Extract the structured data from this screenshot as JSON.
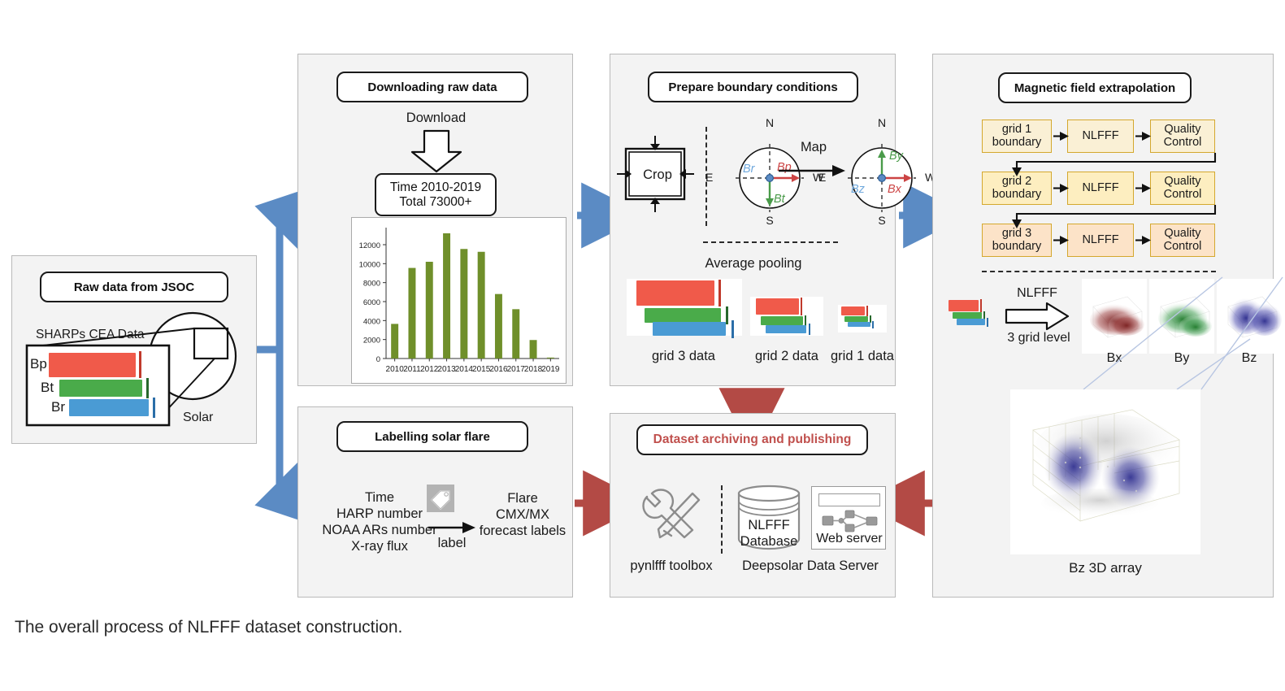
{
  "figure": {
    "caption": "The overall process of NLFFF dataset construction."
  },
  "panels": {
    "jsoc": {
      "title": "Raw data from JSOC",
      "subtitle": "SHARPs CEA Data",
      "solar_label": "Solar",
      "component_labels": [
        "Bp",
        "Bt",
        "Br"
      ],
      "component_colors": [
        "#f05a4a",
        "#4aab4a",
        "#4a9bd4"
      ]
    },
    "download": {
      "title": "Downloading raw data",
      "arrow_label": "Download",
      "summary_line1": "Time 2010-2019",
      "summary_line2": "Total  73000+"
    },
    "boundary": {
      "title": "Prepare boundary conditions",
      "crop_label": "Crop",
      "map_label": "Map",
      "compass_left": {
        "n": "N",
        "s": "S",
        "e": "E",
        "w": "W",
        "vectors": [
          {
            "name": "Bp",
            "color": "#cc4444"
          },
          {
            "name": "Bt",
            "color": "#4a9b4a"
          },
          {
            "name": "Br",
            "color": "#6fa8dc"
          }
        ]
      },
      "compass_right": {
        "n": "N",
        "s": "S",
        "e": "E",
        "w": "W",
        "vectors": [
          {
            "name": "Bx",
            "color": "#cc4444"
          },
          {
            "name": "By",
            "color": "#4a9b4a"
          },
          {
            "name": "Bz",
            "color": "#6fa8dc"
          }
        ]
      },
      "pooling_label": "Average pooling",
      "grid_labels": [
        "grid 3 data",
        "grid 2 data",
        "grid 1 data"
      ]
    },
    "extrapolation": {
      "title": "Magnetic field extrapolation",
      "rows": [
        {
          "boundary": "grid 1\nboundary",
          "solver": "NLFFF",
          "qc": "Quality\nControl",
          "fill": "#faf0d5",
          "border": "#d4a82e"
        },
        {
          "boundary": "grid 2\nboundary",
          "solver": "NLFFF",
          "qc": "Quality\nControl",
          "fill": "#fdeec0",
          "border": "#d4a82e"
        },
        {
          "boundary": "grid 3\nboundary",
          "solver": "NLFFF",
          "qc": "Quality\nControl",
          "fill": "#fce3c8",
          "border": "#d4a82e"
        }
      ],
      "nlfff_arrow_top": "NLFFF",
      "nlfff_arrow_bottom": "3 grid level",
      "component_thumbs": [
        {
          "label": "Bx",
          "color": "#7a2020"
        },
        {
          "label": "By",
          "color": "#1f7a2b"
        },
        {
          "label": "Bz",
          "color": "#2a2a8c"
        }
      ],
      "volume_label": "Bz  3D  array"
    },
    "labelling": {
      "title": "Labelling solar flare",
      "inputs": [
        "Time",
        "HARP number",
        "NOAA ARs number",
        "X-ray flux"
      ],
      "arrow_label": "label",
      "outputs": [
        "Flare",
        "CMX/MX",
        "forecast labels"
      ]
    },
    "archiving": {
      "title": "Dataset archiving and publishing",
      "title_color": "#c0504d",
      "toolbox_label": "pynlfff toolbox",
      "database_line1": "NLFFF",
      "database_line2": "Database",
      "webserver_label": "Web server",
      "server_group_label": "Deepsolar Data Server"
    }
  },
  "chart_data": {
    "type": "bar",
    "title": "",
    "xlabel": "",
    "ylabel": "",
    "categories": [
      "2010",
      "2011",
      "2012",
      "2013",
      "2014",
      "2015",
      "2016",
      "2017",
      "2018",
      "2019"
    ],
    "values": [
      3650,
      9550,
      10200,
      13200,
      11550,
      11250,
      6800,
      5200,
      1950,
      100
    ],
    "yticks": [
      0,
      2000,
      4000,
      6000,
      8000,
      10000,
      12000
    ],
    "ylim": [
      0,
      13800
    ],
    "bar_color": "#6f8f2a",
    "grid": false,
    "legend": null
  },
  "arrows": {
    "blue_color": "#5b8bc4",
    "red_color": "#b34a45"
  }
}
